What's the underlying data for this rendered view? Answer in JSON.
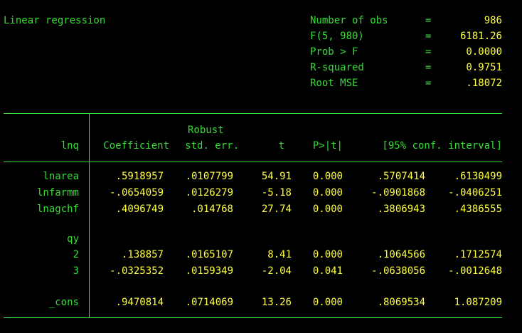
{
  "title": "Linear regression",
  "stats": [
    {
      "label": "Number of obs",
      "eq": "=",
      "value": "986"
    },
    {
      "label": "F(5, 980)",
      "eq": "=",
      "value": "6181.26"
    },
    {
      "label": "Prob > F",
      "eq": "=",
      "value": "0.0000"
    },
    {
      "label": "R-squared",
      "eq": "=",
      "value": "0.9751"
    },
    {
      "label": "Root MSE",
      "eq": "=",
      "value": ".18072"
    }
  ],
  "table": {
    "depvar": "lnq",
    "header_robust": "Robust",
    "columns": [
      "Coefficient",
      "std. err.",
      "t",
      "P>|t|",
      "[95% conf. interval]"
    ],
    "rows": [
      {
        "name": "lnarea",
        "coef": ".5918957",
        "se": ".0107799",
        "t": "54.91",
        "p": "0.000",
        "lo": ".5707414",
        "hi": ".6130499"
      },
      {
        "name": "lnfarmm",
        "coef": "-.0654059",
        "se": ".0126279",
        "t": "-5.18",
        "p": "0.000",
        "lo": "-.0901868",
        "hi": "-.0406251"
      },
      {
        "name": "lnagchf",
        "coef": ".4096749",
        "se": ".014768",
        "t": "27.74",
        "p": "0.000",
        "lo": ".3806943",
        "hi": ".4386555"
      }
    ],
    "group_label": "qy",
    "group_rows": [
      {
        "name": "2",
        "coef": ".138857",
        "se": ".0165107",
        "t": "8.41",
        "p": "0.000",
        "lo": ".1064566",
        "hi": ".1712574"
      },
      {
        "name": "3",
        "coef": "-.0325352",
        "se": ".0159349",
        "t": "-2.04",
        "p": "0.041",
        "lo": "-.0638056",
        "hi": "-.0012648"
      }
    ],
    "cons": {
      "name": "_cons",
      "coef": ".9470814",
      "se": ".0714069",
      "t": "13.26",
      "p": "0.000",
      "lo": ".8069534",
      "hi": "1.087209"
    }
  },
  "colors": {
    "label": "#33dd33",
    "value": "#ffff3c",
    "background": "#000000"
  }
}
